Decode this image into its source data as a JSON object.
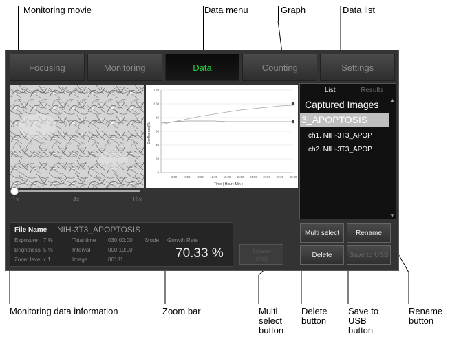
{
  "callouts": {
    "monitoring_movie": "Monitoring movie",
    "data_menu": "Data menu",
    "graph": "Graph",
    "data_list": "Data list",
    "monitoring_data_information": "Monitoring data information",
    "zoom_bar": "Zoom bar",
    "multi_select_1": "Multi",
    "multi_select_2": "select",
    "multi_select_3": "button",
    "delete_1": "Delete",
    "delete_2": "button",
    "save_1": "Save to",
    "save_2": "USB",
    "save_3": "button",
    "rename_1": "Rename",
    "rename_2": "button"
  },
  "tabs": [
    {
      "label": "Focusing"
    },
    {
      "label": "Monitoring"
    },
    {
      "label": "Data"
    },
    {
      "label": "Counting"
    },
    {
      "label": "Settings"
    }
  ],
  "colors": {
    "active_tab": "#1fd13a",
    "screen_bg": "#333333"
  },
  "zoom": {
    "ticks": [
      "1x",
      "4x",
      "16x"
    ],
    "level": 0
  },
  "info": {
    "file_name_label": "File Name",
    "file_name": "NIH-3T3_APOPTOSIS",
    "exposure_label": "Exposure",
    "exposure": "7 %",
    "total_time_label": "Total time",
    "total_time": "030:00:00",
    "mode_label": "Mode",
    "mode": "Growth Rate",
    "brightness_label": "Brightness",
    "brightness": "5 %",
    "interval_label": "Interval",
    "interval": "000:10:00",
    "zoom_label": "Zoom level",
    "zoom_level": "x 1",
    "image_label": "Image",
    "image": "00181",
    "growth_rate": "70.33 %"
  },
  "screen_shot_button": {
    "label_1": "Screen",
    "label_2": "shot"
  },
  "panel": {
    "tab_list": "List",
    "tab_results": "Results",
    "heading": "Captured Images",
    "selected": "3_APOPTOSIS",
    "items": [
      "ch1. NIH-3T3_APOP",
      "ch2. NIH-3T3_APOP"
    ],
    "scroll_up": "▲",
    "scroll_down": "▼"
  },
  "buttons": {
    "multi_select": "Multi select",
    "rename": "Rename",
    "delete": "Delete",
    "save_to_usb": "Save to USB"
  },
  "chart_data": {
    "type": "line",
    "ylabel": "Confluence(%)",
    "xlabel": "Time ( Hour : Min )",
    "ylim": [
      0,
      120
    ],
    "yticks": [
      0,
      20,
      40,
      60,
      80,
      100,
      120
    ],
    "x_ticks": [
      "3:00",
      "6:00",
      "9:00",
      "12:00",
      "15:00",
      "18:00",
      "21:00",
      "24:00",
      "27:00",
      "30:00"
    ],
    "xlim": [
      0,
      30
    ],
    "grid": true,
    "series": [
      {
        "x": [
          0,
          3,
          6,
          9,
          12,
          15,
          18,
          21,
          24,
          27,
          30
        ],
        "values": [
          70,
          74,
          78,
          82,
          85,
          88,
          91,
          93,
          95,
          97,
          98
        ]
      },
      {
        "x": [
          0,
          3,
          6,
          9,
          12,
          15,
          18,
          21,
          24,
          27,
          30
        ],
        "values": [
          72,
          74,
          75,
          75,
          75,
          74,
          74,
          74,
          74,
          74,
          74
        ]
      }
    ],
    "markers": [
      {
        "x": 30,
        "y": 100
      },
      {
        "x": 30,
        "y": 74
      }
    ]
  }
}
